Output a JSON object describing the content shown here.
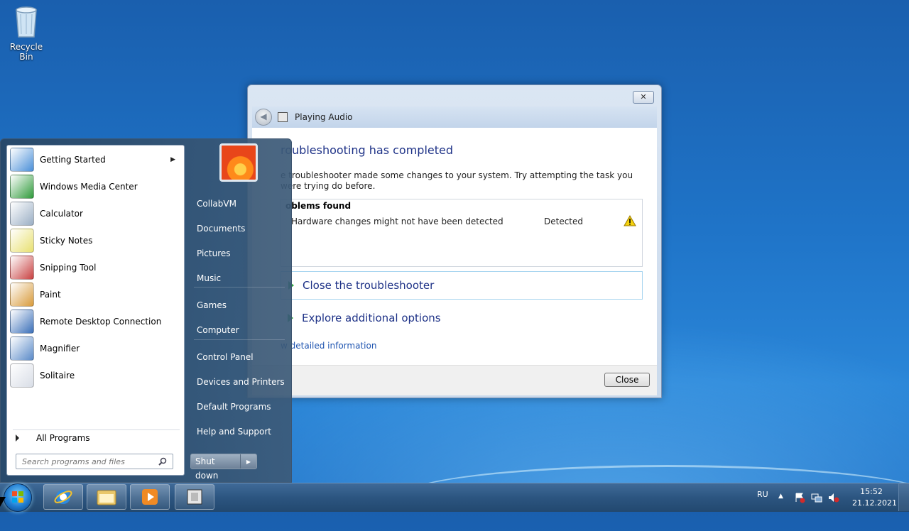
{
  "desktop": {
    "recycle_bin_label": "Recycle Bin"
  },
  "window": {
    "nav_title": "Playing Audio",
    "close_glyph": "✕",
    "heading": "roubleshooting has completed",
    "description": "e troubleshooter made some changes to your system. Try attempting the task you were trying do before.",
    "problems_header": "oblems found",
    "problems": [
      {
        "text": "Hardware changes might not have been detected",
        "status": "Detected"
      }
    ],
    "options": [
      {
        "label": "Close the troubleshooter"
      },
      {
        "label": "Explore additional options"
      }
    ],
    "detail_link": "w detailed information",
    "close_button": "Close"
  },
  "start_menu": {
    "programs": [
      {
        "label": "Getting Started",
        "icon": "getting-started-icon",
        "color": "#4a8fd8",
        "has_submenu": true
      },
      {
        "label": "Windows Media Center",
        "icon": "media-center-icon",
        "color": "#2e9a3a"
      },
      {
        "label": "Calculator",
        "icon": "calculator-icon",
        "color": "#9aaec4"
      },
      {
        "label": "Sticky Notes",
        "icon": "sticky-notes-icon",
        "color": "#e8e070"
      },
      {
        "label": "Snipping Tool",
        "icon": "snipping-tool-icon",
        "color": "#c84040"
      },
      {
        "label": "Paint",
        "icon": "paint-icon",
        "color": "#d89a3a"
      },
      {
        "label": "Remote Desktop Connection",
        "icon": "remote-desktop-icon",
        "color": "#3a6fb8"
      },
      {
        "label": "Magnifier",
        "icon": "magnifier-icon",
        "color": "#5a8ac8"
      },
      {
        "label": "Solitaire",
        "icon": "solitaire-icon",
        "color": "#d8dde6"
      }
    ],
    "submenu_arrow": "▶",
    "all_programs": "All Programs",
    "search_placeholder": "Search programs and files",
    "places": [
      "CollabVM",
      "Documents",
      "Pictures",
      "Music",
      "Games",
      "Computer",
      "Control Panel",
      "Devices and Printers",
      "Default Programs",
      "Help and Support"
    ],
    "shutdown_label": "Shut down",
    "shutdown_arrow": "▶"
  },
  "taskbar": {
    "language": "RU",
    "time": "15:52",
    "date": "21.12.2021",
    "tray_up_arrow": "▲"
  }
}
